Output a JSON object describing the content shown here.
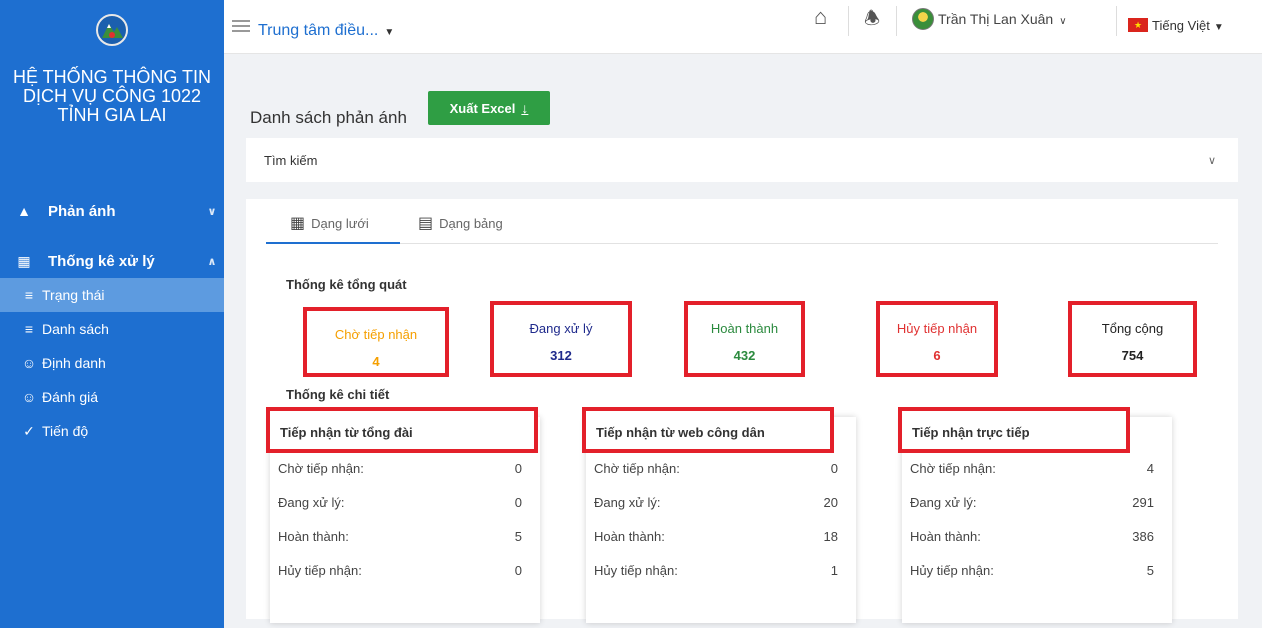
{
  "sidebar": {
    "system_title": "HỆ THỐNG THÔNG TIN DỊCH VỤ CÔNG 1022 TỈNH GIA LAI",
    "groups": [
      {
        "label": "Phản ánh",
        "expanded": false
      },
      {
        "label": "Thống kê xử lý",
        "expanded": true
      }
    ],
    "items": [
      {
        "label": "Trạng thái",
        "active": true
      },
      {
        "label": "Danh sách",
        "active": false
      },
      {
        "label": "Định danh",
        "active": false
      },
      {
        "label": "Đánh giá",
        "active": false
      },
      {
        "label": "Tiến độ",
        "active": false
      }
    ],
    "colors": {
      "background": "#1e6fd0",
      "active_item": "#5d9be0"
    }
  },
  "topbar": {
    "unit": "Trung tâm điều...",
    "user": "Trần Thị Lan Xuân",
    "language": "Tiếng Việt",
    "icons": [
      "menu-icon",
      "home-icon",
      "bell-icon",
      "avatar",
      "vietnam-flag-icon"
    ]
  },
  "page": {
    "title": "Danh sách phản ánh",
    "export_label": "Xuất Excel",
    "search_label": "Tìm kiếm",
    "tabs": [
      {
        "label": "Dạng lưới",
        "icon": "grid-icon",
        "active": true
      },
      {
        "label": "Dạng bảng",
        "icon": "table-icon",
        "active": false
      }
    ]
  },
  "overview": {
    "title": "Thống kê tổng quát",
    "stats": [
      {
        "label": "Chờ tiếp nhận",
        "value": "4",
        "color": "#f59f00"
      },
      {
        "label": "Đang xử lý",
        "value": "312",
        "color": "#1f2a8c"
      },
      {
        "label": "Hoàn thành",
        "value": "432",
        "color": "#2b8a3e"
      },
      {
        "label": "Hủy tiếp nhận",
        "value": "6",
        "color": "#e03131"
      },
      {
        "label": "Tổng cộng",
        "value": "754",
        "color": "#222222"
      }
    ]
  },
  "detail": {
    "title": "Thống kê chi tiết",
    "sources": [
      {
        "title": "Tiếp nhận từ tổng đài",
        "rows": [
          {
            "label": "Chờ tiếp nhận:",
            "value": "0"
          },
          {
            "label": "Đang xử lý:",
            "value": "0"
          },
          {
            "label": "Hoàn thành:",
            "value": "5"
          },
          {
            "label": "Hủy tiếp nhận:",
            "value": "0"
          }
        ]
      },
      {
        "title": "Tiếp nhận từ web công dân",
        "rows": [
          {
            "label": "Chờ tiếp nhận:",
            "value": "0"
          },
          {
            "label": "Đang xử lý:",
            "value": "20"
          },
          {
            "label": "Hoàn thành:",
            "value": "18"
          },
          {
            "label": "Hủy tiếp nhận:",
            "value": "1"
          }
        ]
      },
      {
        "title": "Tiếp nhận trực tiếp",
        "rows": [
          {
            "label": "Chờ tiếp nhận:",
            "value": "4"
          },
          {
            "label": "Đang xử lý:",
            "value": "291"
          },
          {
            "label": "Hoàn thành:",
            "value": "386"
          },
          {
            "label": "Hủy tiếp nhận:",
            "value": "5"
          }
        ]
      }
    ]
  },
  "colors": {
    "highlight_border": "#e3202a",
    "export_button": "#2f9e44",
    "brand": "#1e6fd0"
  }
}
